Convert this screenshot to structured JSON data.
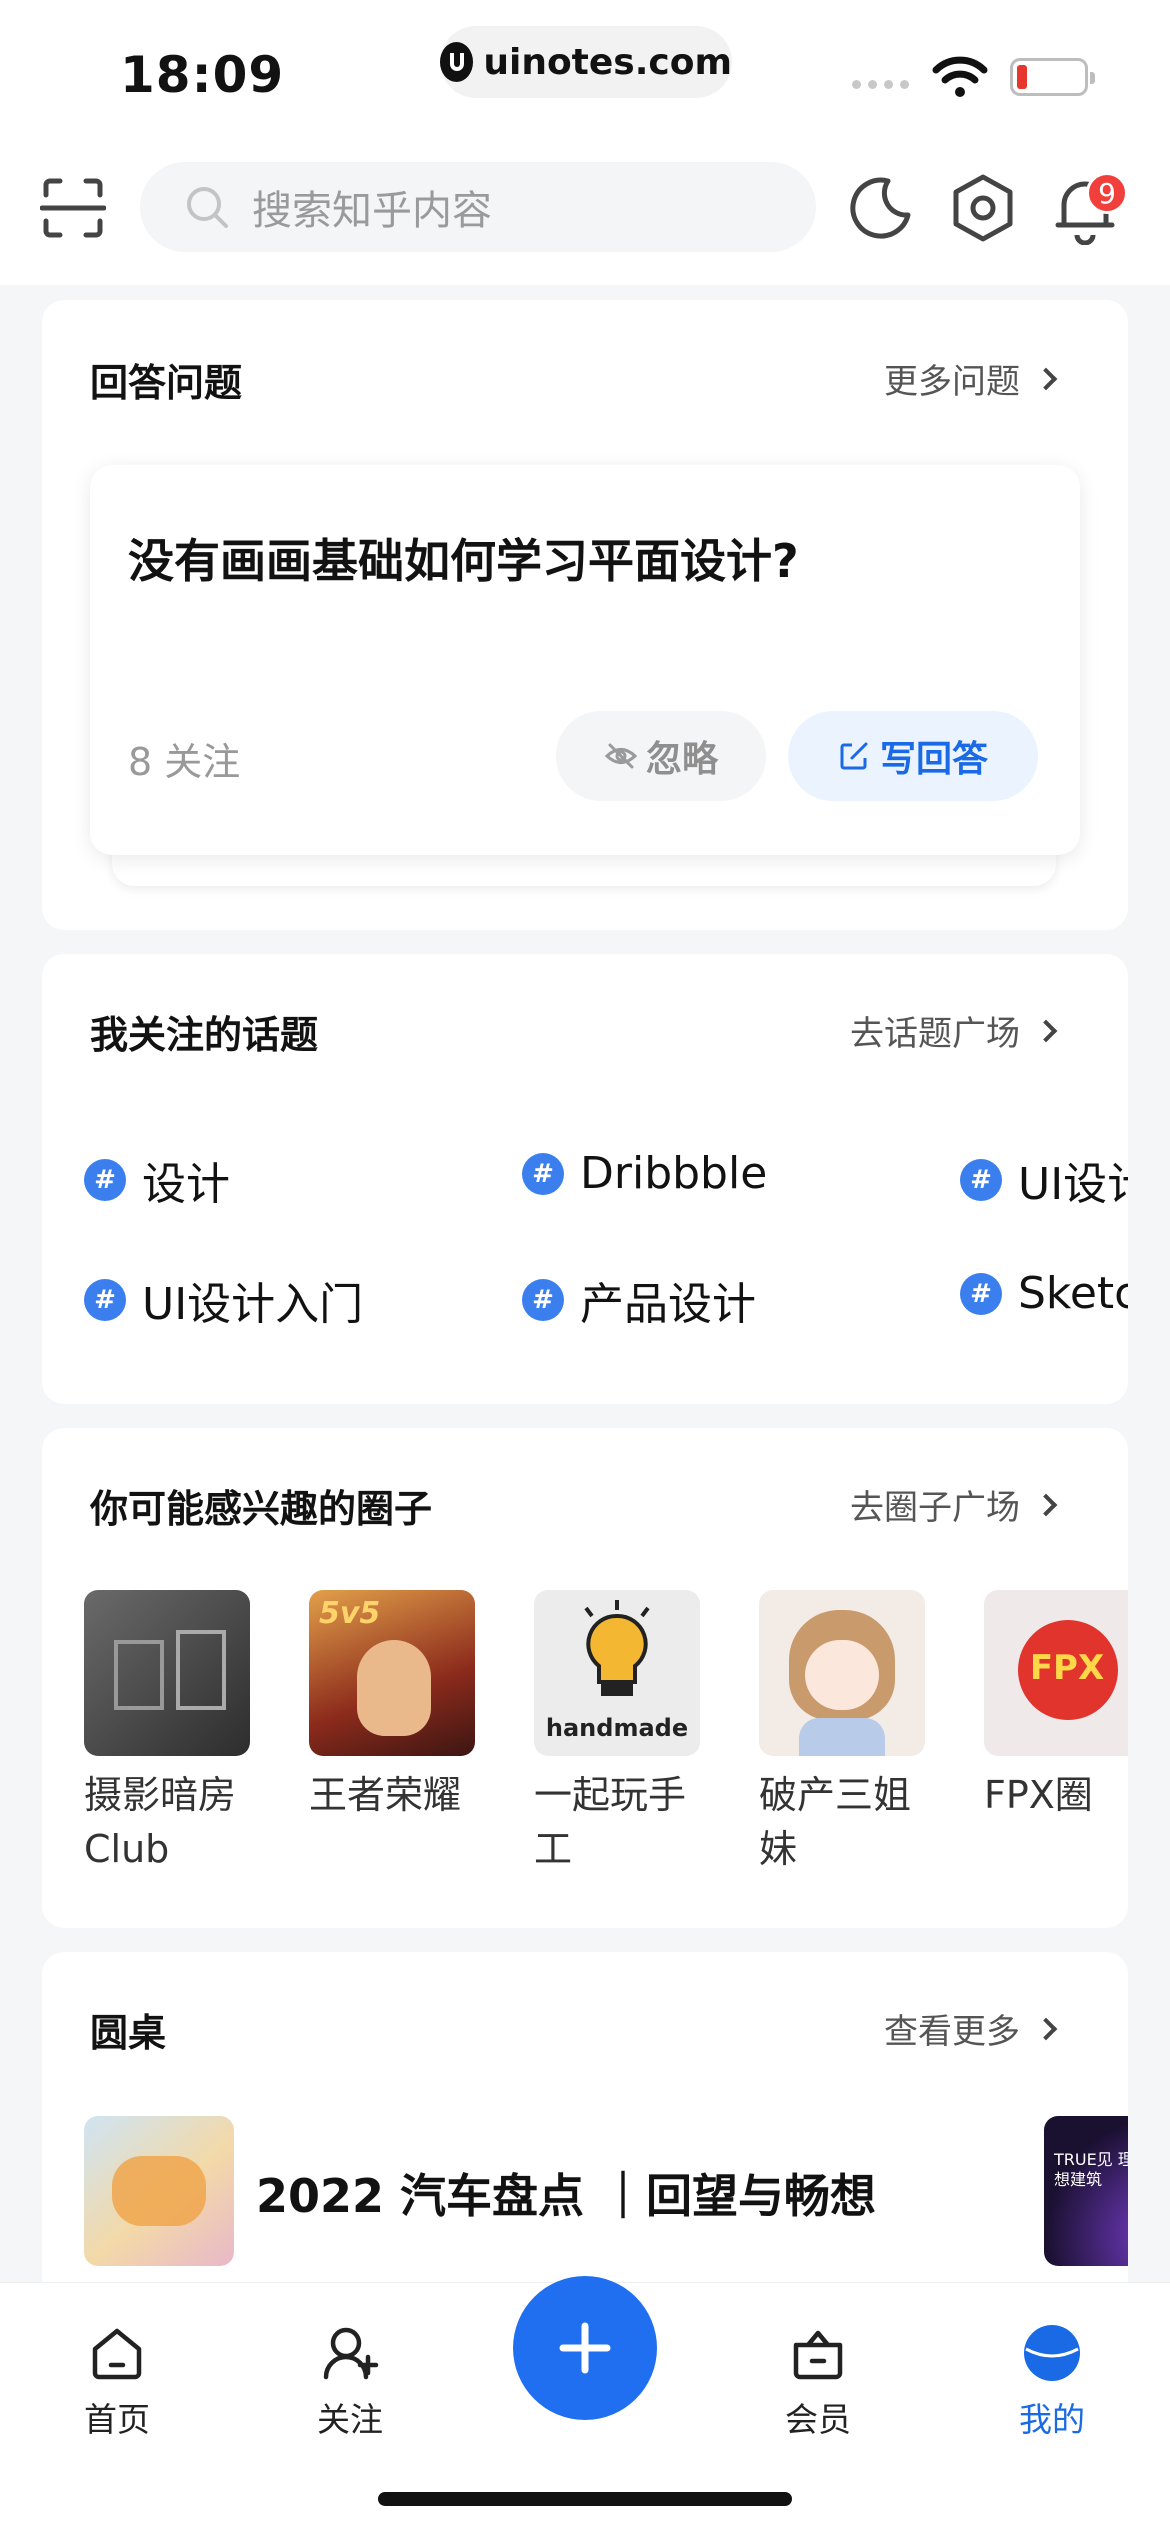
{
  "status": {
    "time": "18:09",
    "url": "uinotes.com"
  },
  "header": {
    "search_placeholder": "搜索知乎内容",
    "notification_count": "9"
  },
  "answer_section": {
    "title": "回答问题",
    "more": "更多问题",
    "question": "没有画画基础如何学习平面设计?",
    "follow_count": "8 关注",
    "ignore_label": "忽略",
    "answer_label": "写回答"
  },
  "topics_section": {
    "title": "我关注的话题",
    "more": "去话题广场",
    "topics": [
      "设计",
      "Dribbble",
      "UI设计",
      "UI设计入门",
      "产品设计",
      "Sketch"
    ]
  },
  "circles_section": {
    "title": "你可能感兴趣的圈子",
    "more": "去圈子广场",
    "circles": [
      {
        "name": "摄影暗房\nClub"
      },
      {
        "name": "王者荣耀",
        "badge_text": "5v5"
      },
      {
        "name": "一起玩手\n工",
        "image_text": "handmade"
      },
      {
        "name": "破产三姐\n妹"
      },
      {
        "name": "FPX圈",
        "image_text": "FPX"
      }
    ]
  },
  "roundtable_section": {
    "title": "圆桌",
    "more": "查看更多",
    "item_title": "2022 汽车盘点 ｜回望与畅想",
    "next_thumb_text": "TRUE见 理想建筑"
  },
  "tabbar": {
    "tabs": [
      {
        "label": "首页"
      },
      {
        "label": "关注"
      },
      {
        "label": "会员"
      },
      {
        "label": "我的"
      }
    ],
    "active_color": "#1a6ae6"
  }
}
